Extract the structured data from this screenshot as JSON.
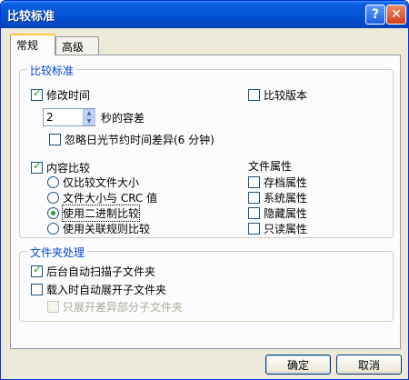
{
  "window": {
    "title": "比较标准",
    "help_glyph": "?",
    "close_glyph": "✕"
  },
  "tabs": [
    {
      "label": "常规",
      "active": true
    },
    {
      "label": "高级",
      "active": false
    }
  ],
  "compare_group": {
    "title": "比较标准",
    "modify_time": {
      "label": "修改时间",
      "checked": true
    },
    "tolerance": {
      "value": "2",
      "unit_label": "秒的容差"
    },
    "ignore_dst": {
      "label": "忽略日光节约时间差异(6 分钟)",
      "checked": false
    },
    "compare_version": {
      "label": "比较版本",
      "checked": false
    },
    "content_compare": {
      "label": "内容比较",
      "checked": true
    },
    "options": [
      {
        "label": "仅比较文件大小",
        "checked": false
      },
      {
        "label": "文件大小与 CRC 值",
        "checked": false
      },
      {
        "label": "使用二进制比较",
        "checked": true
      },
      {
        "label": "使用关联规则比较",
        "checked": false
      }
    ],
    "file_attrs": {
      "title": "文件属性",
      "items": [
        {
          "label": "存档属性",
          "checked": false
        },
        {
          "label": "系统属性",
          "checked": false
        },
        {
          "label": "隐藏属性",
          "checked": false
        },
        {
          "label": "只读属性",
          "checked": false
        }
      ]
    }
  },
  "folder_group": {
    "title": "文件夹处理",
    "auto_scan": {
      "label": "后台自动扫描子文件夹",
      "checked": true
    },
    "auto_expand": {
      "label": "载入时自动展开子文件夹",
      "checked": false
    },
    "expand_diff": {
      "label": "只展开差异部分子文件夹",
      "checked": false,
      "disabled": true
    }
  },
  "buttons": {
    "ok": "确定",
    "cancel": "取消"
  }
}
